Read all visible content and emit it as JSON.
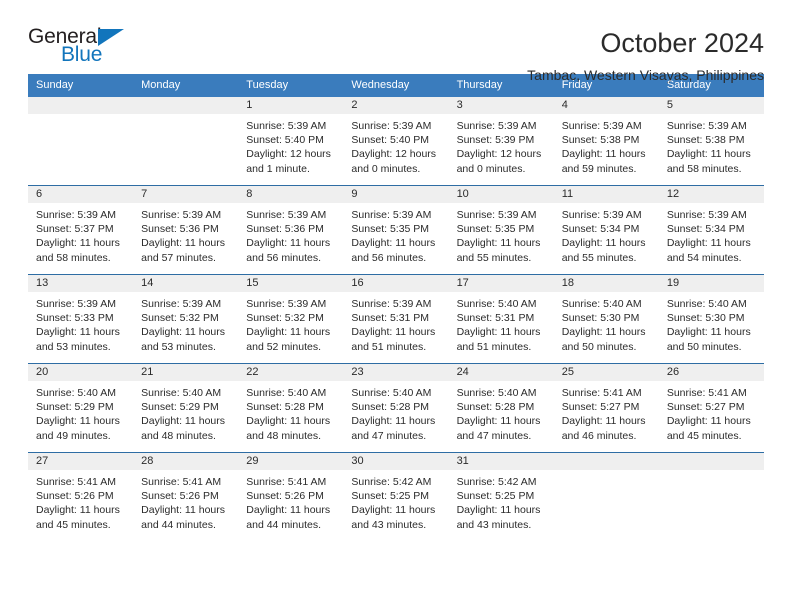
{
  "brand": {
    "name_part1": "General",
    "name_part2": "Blue",
    "triangle_color": "#1275bc",
    "icon": "triangle-logo-icon"
  },
  "header": {
    "title": "October 2024",
    "subtitle": "Tambac, Western Visayas, Philippines"
  },
  "theme": {
    "header_blue": "#3a7cbd",
    "rule_blue": "#2e6da4",
    "daynum_bg": "#efefef",
    "text": "#2b2b2b"
  },
  "calendar": {
    "weekday_headers": [
      "Sunday",
      "Monday",
      "Tuesday",
      "Wednesday",
      "Thursday",
      "Friday",
      "Saturday"
    ],
    "weeks": [
      [
        {
          "day": "",
          "sunrise": "",
          "sunset": "",
          "daylight_line1": "",
          "daylight_line2": ""
        },
        {
          "day": "",
          "sunrise": "",
          "sunset": "",
          "daylight_line1": "",
          "daylight_line2": ""
        },
        {
          "day": "1",
          "sunrise": "Sunrise: 5:39 AM",
          "sunset": "Sunset: 5:40 PM",
          "daylight_line1": "Daylight: 12 hours",
          "daylight_line2": "and 1 minute."
        },
        {
          "day": "2",
          "sunrise": "Sunrise: 5:39 AM",
          "sunset": "Sunset: 5:40 PM",
          "daylight_line1": "Daylight: 12 hours",
          "daylight_line2": "and 0 minutes."
        },
        {
          "day": "3",
          "sunrise": "Sunrise: 5:39 AM",
          "sunset": "Sunset: 5:39 PM",
          "daylight_line1": "Daylight: 12 hours",
          "daylight_line2": "and 0 minutes."
        },
        {
          "day": "4",
          "sunrise": "Sunrise: 5:39 AM",
          "sunset": "Sunset: 5:38 PM",
          "daylight_line1": "Daylight: 11 hours",
          "daylight_line2": "and 59 minutes."
        },
        {
          "day": "5",
          "sunrise": "Sunrise: 5:39 AM",
          "sunset": "Sunset: 5:38 PM",
          "daylight_line1": "Daylight: 11 hours",
          "daylight_line2": "and 58 minutes."
        }
      ],
      [
        {
          "day": "6",
          "sunrise": "Sunrise: 5:39 AM",
          "sunset": "Sunset: 5:37 PM",
          "daylight_line1": "Daylight: 11 hours",
          "daylight_line2": "and 58 minutes."
        },
        {
          "day": "7",
          "sunrise": "Sunrise: 5:39 AM",
          "sunset": "Sunset: 5:36 PM",
          "daylight_line1": "Daylight: 11 hours",
          "daylight_line2": "and 57 minutes."
        },
        {
          "day": "8",
          "sunrise": "Sunrise: 5:39 AM",
          "sunset": "Sunset: 5:36 PM",
          "daylight_line1": "Daylight: 11 hours",
          "daylight_line2": "and 56 minutes."
        },
        {
          "day": "9",
          "sunrise": "Sunrise: 5:39 AM",
          "sunset": "Sunset: 5:35 PM",
          "daylight_line1": "Daylight: 11 hours",
          "daylight_line2": "and 56 minutes."
        },
        {
          "day": "10",
          "sunrise": "Sunrise: 5:39 AM",
          "sunset": "Sunset: 5:35 PM",
          "daylight_line1": "Daylight: 11 hours",
          "daylight_line2": "and 55 minutes."
        },
        {
          "day": "11",
          "sunrise": "Sunrise: 5:39 AM",
          "sunset": "Sunset: 5:34 PM",
          "daylight_line1": "Daylight: 11 hours",
          "daylight_line2": "and 55 minutes."
        },
        {
          "day": "12",
          "sunrise": "Sunrise: 5:39 AM",
          "sunset": "Sunset: 5:34 PM",
          "daylight_line1": "Daylight: 11 hours",
          "daylight_line2": "and 54 minutes."
        }
      ],
      [
        {
          "day": "13",
          "sunrise": "Sunrise: 5:39 AM",
          "sunset": "Sunset: 5:33 PM",
          "daylight_line1": "Daylight: 11 hours",
          "daylight_line2": "and 53 minutes."
        },
        {
          "day": "14",
          "sunrise": "Sunrise: 5:39 AM",
          "sunset": "Sunset: 5:32 PM",
          "daylight_line1": "Daylight: 11 hours",
          "daylight_line2": "and 53 minutes."
        },
        {
          "day": "15",
          "sunrise": "Sunrise: 5:39 AM",
          "sunset": "Sunset: 5:32 PM",
          "daylight_line1": "Daylight: 11 hours",
          "daylight_line2": "and 52 minutes."
        },
        {
          "day": "16",
          "sunrise": "Sunrise: 5:39 AM",
          "sunset": "Sunset: 5:31 PM",
          "daylight_line1": "Daylight: 11 hours",
          "daylight_line2": "and 51 minutes."
        },
        {
          "day": "17",
          "sunrise": "Sunrise: 5:40 AM",
          "sunset": "Sunset: 5:31 PM",
          "daylight_line1": "Daylight: 11 hours",
          "daylight_line2": "and 51 minutes."
        },
        {
          "day": "18",
          "sunrise": "Sunrise: 5:40 AM",
          "sunset": "Sunset: 5:30 PM",
          "daylight_line1": "Daylight: 11 hours",
          "daylight_line2": "and 50 minutes."
        },
        {
          "day": "19",
          "sunrise": "Sunrise: 5:40 AM",
          "sunset": "Sunset: 5:30 PM",
          "daylight_line1": "Daylight: 11 hours",
          "daylight_line2": "and 50 minutes."
        }
      ],
      [
        {
          "day": "20",
          "sunrise": "Sunrise: 5:40 AM",
          "sunset": "Sunset: 5:29 PM",
          "daylight_line1": "Daylight: 11 hours",
          "daylight_line2": "and 49 minutes."
        },
        {
          "day": "21",
          "sunrise": "Sunrise: 5:40 AM",
          "sunset": "Sunset: 5:29 PM",
          "daylight_line1": "Daylight: 11 hours",
          "daylight_line2": "and 48 minutes."
        },
        {
          "day": "22",
          "sunrise": "Sunrise: 5:40 AM",
          "sunset": "Sunset: 5:28 PM",
          "daylight_line1": "Daylight: 11 hours",
          "daylight_line2": "and 48 minutes."
        },
        {
          "day": "23",
          "sunrise": "Sunrise: 5:40 AM",
          "sunset": "Sunset: 5:28 PM",
          "daylight_line1": "Daylight: 11 hours",
          "daylight_line2": "and 47 minutes."
        },
        {
          "day": "24",
          "sunrise": "Sunrise: 5:40 AM",
          "sunset": "Sunset: 5:28 PM",
          "daylight_line1": "Daylight: 11 hours",
          "daylight_line2": "and 47 minutes."
        },
        {
          "day": "25",
          "sunrise": "Sunrise: 5:41 AM",
          "sunset": "Sunset: 5:27 PM",
          "daylight_line1": "Daylight: 11 hours",
          "daylight_line2": "and 46 minutes."
        },
        {
          "day": "26",
          "sunrise": "Sunrise: 5:41 AM",
          "sunset": "Sunset: 5:27 PM",
          "daylight_line1": "Daylight: 11 hours",
          "daylight_line2": "and 45 minutes."
        }
      ],
      [
        {
          "day": "27",
          "sunrise": "Sunrise: 5:41 AM",
          "sunset": "Sunset: 5:26 PM",
          "daylight_line1": "Daylight: 11 hours",
          "daylight_line2": "and 45 minutes."
        },
        {
          "day": "28",
          "sunrise": "Sunrise: 5:41 AM",
          "sunset": "Sunset: 5:26 PM",
          "daylight_line1": "Daylight: 11 hours",
          "daylight_line2": "and 44 minutes."
        },
        {
          "day": "29",
          "sunrise": "Sunrise: 5:41 AM",
          "sunset": "Sunset: 5:26 PM",
          "daylight_line1": "Daylight: 11 hours",
          "daylight_line2": "and 44 minutes."
        },
        {
          "day": "30",
          "sunrise": "Sunrise: 5:42 AM",
          "sunset": "Sunset: 5:25 PM",
          "daylight_line1": "Daylight: 11 hours",
          "daylight_line2": "and 43 minutes."
        },
        {
          "day": "31",
          "sunrise": "Sunrise: 5:42 AM",
          "sunset": "Sunset: 5:25 PM",
          "daylight_line1": "Daylight: 11 hours",
          "daylight_line2": "and 43 minutes."
        },
        {
          "day": "",
          "sunrise": "",
          "sunset": "",
          "daylight_line1": "",
          "daylight_line2": ""
        },
        {
          "day": "",
          "sunrise": "",
          "sunset": "",
          "daylight_line1": "",
          "daylight_line2": ""
        }
      ]
    ]
  }
}
